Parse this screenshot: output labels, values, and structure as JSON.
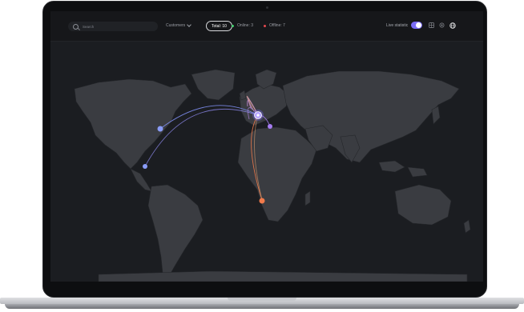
{
  "topbar": {
    "search_placeholder": "Search",
    "customers_label": "Customers",
    "total_label": "Total: 10",
    "online_label": "Online: 3",
    "offline_label": "Offline: 7",
    "live_label": "Live statistic",
    "live_on": true
  },
  "colors": {
    "accent": "#7a6cf5",
    "online": "#3ecf6b",
    "offline": "#e5484d",
    "node_blue": "#8a9cf7",
    "node_purple": "#a67cf2",
    "node_orange": "#f07a4b",
    "hub": "#b7a6ff"
  },
  "icons": [
    "search-icon",
    "chevron-down-icon",
    "grid-icon",
    "settings-icon",
    "globe-icon"
  ]
}
